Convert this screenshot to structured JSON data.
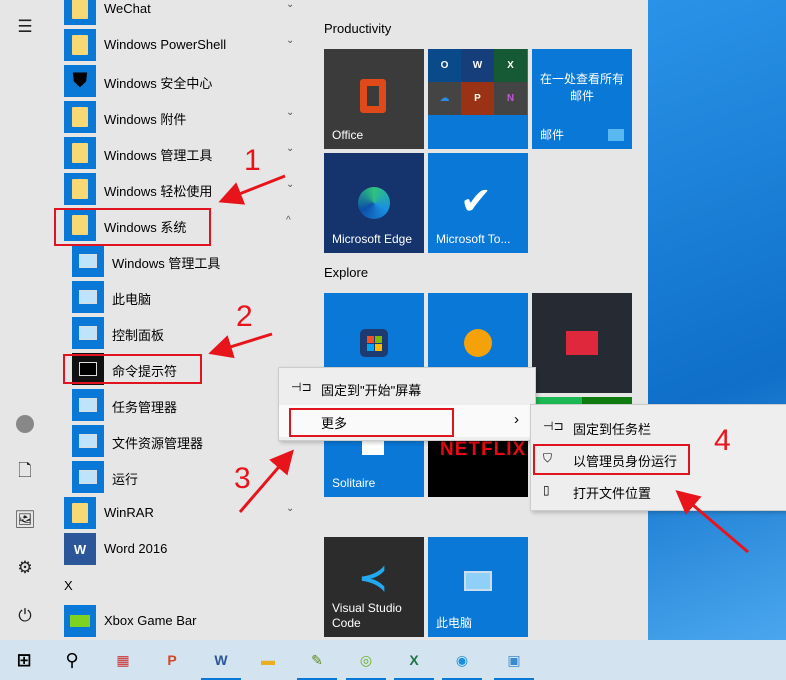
{
  "rail": [
    "menu-icon",
    "user-icon",
    "document-icon",
    "pictures-icon",
    "settings-icon",
    "power-icon"
  ],
  "apps": [
    {
      "label": "WeChat",
      "icon": "folder",
      "chevron": "⌄"
    },
    {
      "label": "Windows PowerShell",
      "icon": "folder",
      "chevron": "⌄"
    },
    {
      "label": "Windows 安全中心",
      "icon": "shield"
    },
    {
      "label": "Windows 附件",
      "icon": "folder",
      "chevron": "⌄"
    },
    {
      "label": "Windows 管理工具",
      "icon": "folder",
      "chevron": "⌄"
    },
    {
      "label": "Windows 轻松使用",
      "icon": "folder",
      "chevron": "⌄"
    },
    {
      "label": "Windows 系统",
      "icon": "folder",
      "chevron": "^"
    }
  ],
  "subapps": [
    "Windows 管理工具",
    "此电脑",
    "控制面板",
    "命令提示符",
    "任务管理器",
    "文件资源管理器",
    "运行"
  ],
  "apps2": [
    {
      "label": "WinRAR",
      "chevron": "⌄"
    },
    {
      "label": "Word 2016"
    }
  ],
  "letter_x": "X",
  "xbox": "Xbox Game Bar",
  "groups": {
    "productivity": "Productivity",
    "explore": "Explore"
  },
  "tiles": {
    "office": "Office",
    "mail_text": "在一处查看所有邮件",
    "mail": "邮件",
    "edge": "Microsoft Edge",
    "todo": "Microsoft To...",
    "solitaire": "Solitaire",
    "netflix": "NETFLIX",
    "vscode": "Visual Studio Code",
    "thispc": "此电脑"
  },
  "context_menu": {
    "pin_start": "固定到\"开始\"屏幕",
    "more": "更多"
  },
  "submenu": {
    "pin_taskbar": "固定到任务栏",
    "run_admin": "以管理员身份运行",
    "open_location": "打开文件位置"
  },
  "annotations": [
    "1",
    "2",
    "3",
    "4"
  ],
  "annotation_color": "#e8141c",
  "accent": "#0a78d7"
}
